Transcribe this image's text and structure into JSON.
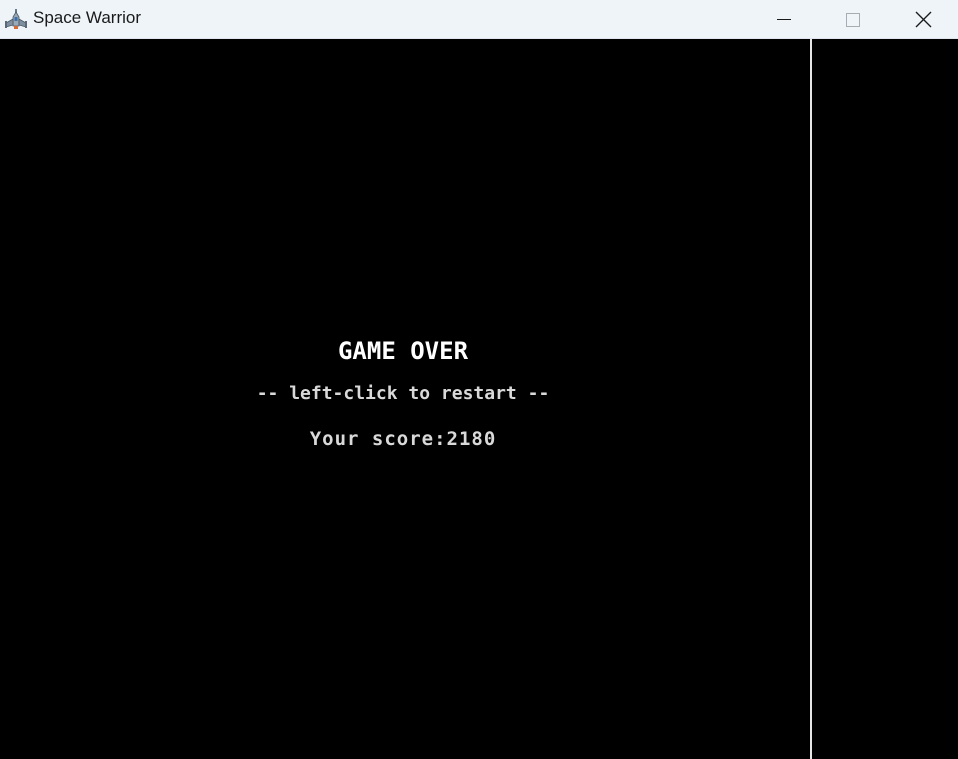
{
  "window": {
    "title": "Space Warrior",
    "app_icon": "spaceship-icon",
    "controls": [
      "minimize-icon",
      "maximize-icon",
      "close-icon"
    ],
    "titlebar_color": "#eff4f9"
  },
  "game": {
    "background_color": "#000000",
    "game_over_label": "GAME OVER",
    "restart_hint": "-- left-click to restart --",
    "score_label": "Your score:",
    "score_value": "2180",
    "text_color": "#d9d9d9"
  }
}
